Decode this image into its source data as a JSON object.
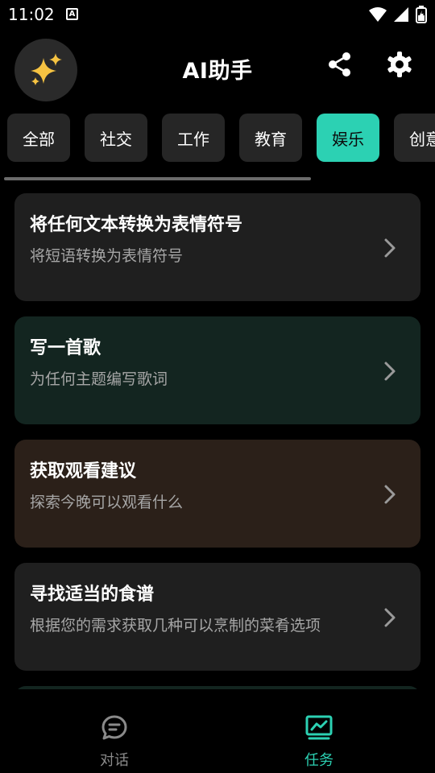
{
  "status": {
    "time": "11:02",
    "a_icon_letter": "A"
  },
  "header": {
    "title": "AI助手",
    "logo_icon": "sparkles-icon"
  },
  "tabs": [
    {
      "label": "全部"
    },
    {
      "label": "社交"
    },
    {
      "label": "工作"
    },
    {
      "label": "教育"
    },
    {
      "label": "娱乐",
      "active": true
    },
    {
      "label": "创意"
    }
  ],
  "cards": [
    {
      "title": "将任何文本转换为表情符号",
      "subtitle": "将短语转换为表情符号",
      "bg": "#1f1f1f"
    },
    {
      "title": "写一首歌",
      "subtitle": "为任何主题编写歌词",
      "bg": "#132520"
    },
    {
      "title": "获取观看建议",
      "subtitle": "探索今晚可以观看什么",
      "bg": "#2b2019"
    },
    {
      "title": "寻找适当的食谱",
      "subtitle": "根据您的需求获取几种可以烹制的菜肴选项",
      "bg": "#1f1f1f"
    }
  ],
  "bottom_nav": {
    "chat_label": "对话",
    "tasks_label": "任务"
  },
  "colors": {
    "accent": "#2cd1b3",
    "inactive": "#8a8a8a"
  }
}
